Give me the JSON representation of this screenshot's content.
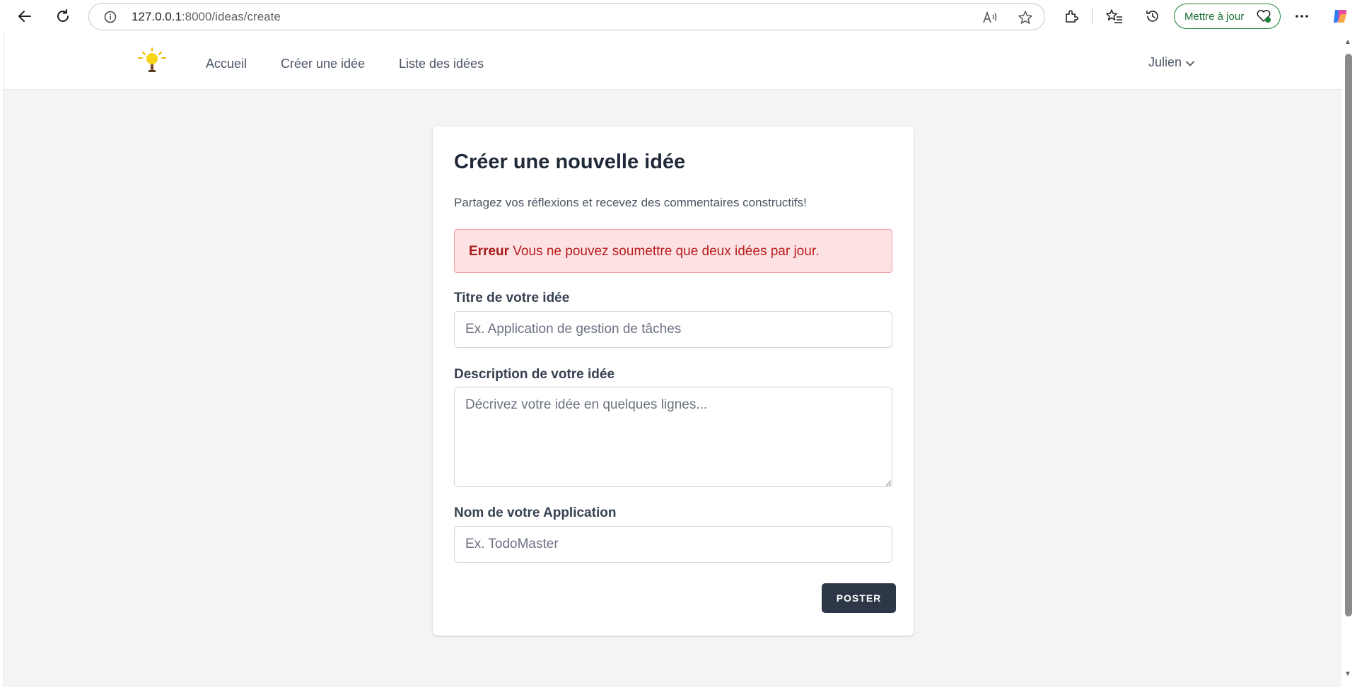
{
  "browser": {
    "url_host": "127.0.0.1",
    "url_path": ":8000/ideas/create",
    "update_label": "Mettre à jour"
  },
  "nav": {
    "links": [
      "Accueil",
      "Créer une idée",
      "Liste des idées"
    ],
    "user": "Julien"
  },
  "form": {
    "title": "Créer une nouvelle idée",
    "subtitle": "Partagez vos réflexions et recevez des commentaires constructifs!",
    "error_prefix": "Erreur",
    "error_message": " Vous ne pouvez soumettre que deux idées par jour.",
    "title_label": "Titre de votre idée",
    "title_placeholder": "Ex. Application de gestion de tâches",
    "description_label": "Description de votre idée",
    "description_placeholder": "Décrivez votre idée en quelques lignes...",
    "app_label": "Nom de votre Application",
    "app_placeholder": "Ex. TodoMaster",
    "submit_label": "POSTER"
  },
  "colors": {
    "primary_button": "#2d3748",
    "error_bg": "#fde2e4",
    "error_text": "#b91c1c",
    "page_bg": "#f3f4f6"
  }
}
